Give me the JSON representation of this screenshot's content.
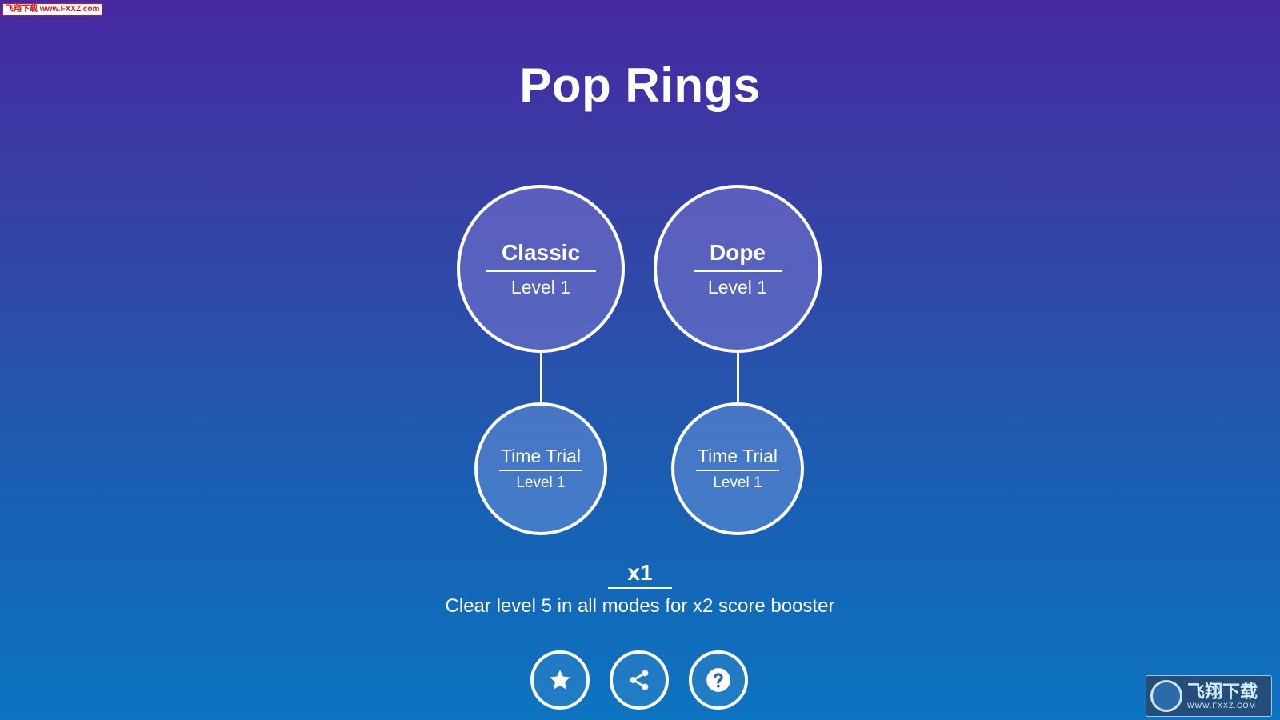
{
  "title": "Pop Rings",
  "modes": [
    {
      "name": "Classic",
      "level": "Level 1"
    },
    {
      "name": "Dope",
      "level": "Level 1"
    },
    {
      "name": "Time Trial",
      "level": "Level 1"
    },
    {
      "name": "Time Trial",
      "level": "Level 1"
    }
  ],
  "booster": {
    "multiplier": "x1",
    "message": "Clear level 5 in all modes for x2 score booster"
  },
  "buttons": {
    "rate_icon": "star-icon",
    "share_icon": "share-icon",
    "help_icon": "help-icon"
  },
  "watermark": {
    "top_text": "飞翔下载 www.FXXZ.com",
    "bottom_cn": "飞翔下载",
    "bottom_url": "WWW.FXXZ.COM"
  },
  "colors": {
    "bg_top": "#4629a1",
    "bg_bottom": "#0c74c0",
    "ring_border": "#ffffff"
  }
}
